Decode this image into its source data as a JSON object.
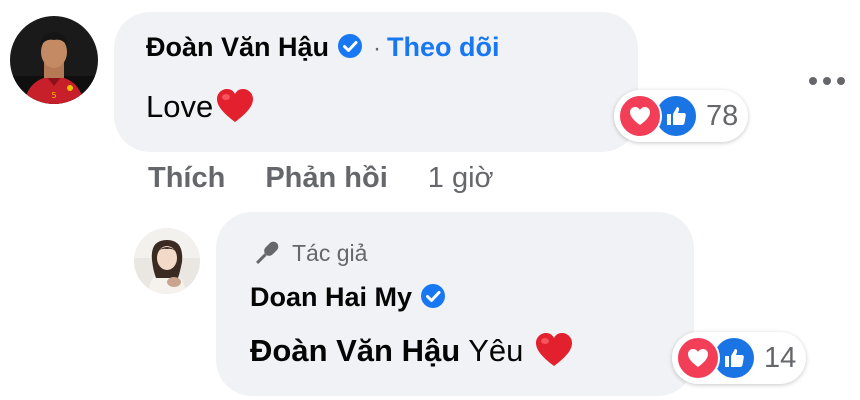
{
  "comment1": {
    "author": "Đoàn Văn Hậu",
    "follow_separator": "·",
    "follow_label": "Theo dõi",
    "text": "Love",
    "reaction_count": "78",
    "actions": {
      "like": "Thích",
      "reply": "Phản hồi",
      "time": "1 giờ"
    }
  },
  "reply1": {
    "author_badge": "Tác giả",
    "author": "Doan Hai My",
    "mention": "Đoàn Văn Hậu",
    "text": "Yêu",
    "reaction_count": "14"
  },
  "colors": {
    "bubble": "#f0f2f5",
    "link_blue": "#1877f2",
    "muted": "#65676b",
    "love_red": "#f33e58",
    "like_blue": "#1b74e4"
  },
  "icons": [
    "verified-badge-icon",
    "heart-emoji-icon",
    "love-reaction-icon",
    "like-reaction-icon",
    "more-options-icon",
    "author-mic-icon"
  ]
}
